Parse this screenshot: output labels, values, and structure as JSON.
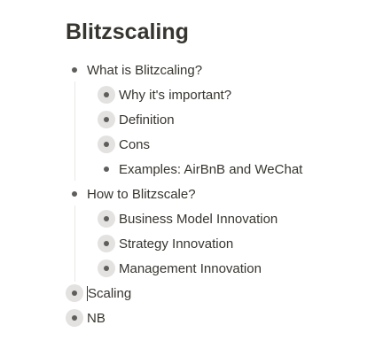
{
  "page": {
    "title": "Blitzscaling"
  },
  "outline": [
    {
      "label": "What is Blitzcaling?",
      "children": [
        {
          "label": "Why it's important?",
          "collapsed": true
        },
        {
          "label": "Definition",
          "collapsed": true
        },
        {
          "label": "Cons",
          "collapsed": true
        },
        {
          "label": "Examples: AirBnB and WeChat",
          "collapsed": false
        }
      ]
    },
    {
      "label": "How to Blitzscale?",
      "children": [
        {
          "label": "Business Model Innovation",
          "collapsed": true
        },
        {
          "label": "Strategy Innovation",
          "collapsed": true
        },
        {
          "label": "Management Innovation",
          "collapsed": true
        }
      ]
    },
    {
      "label": "Scaling",
      "collapsed": true,
      "editing": true
    },
    {
      "label": "NB",
      "collapsed": true
    }
  ]
}
